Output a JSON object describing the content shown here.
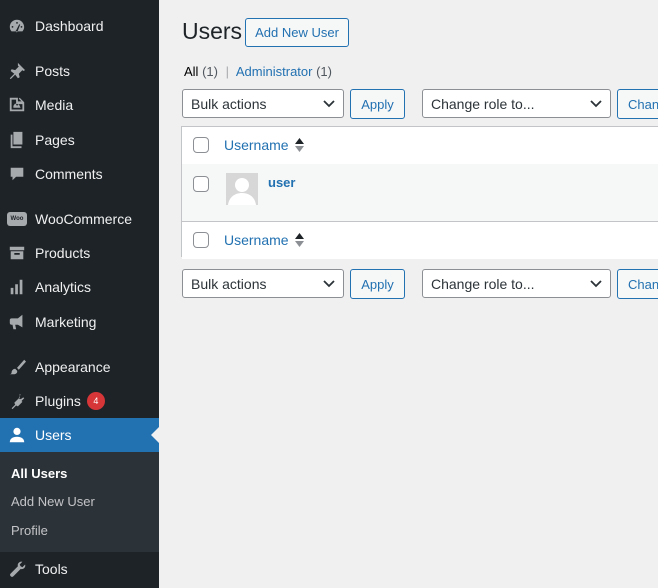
{
  "sidebar": {
    "items": [
      {
        "label": "Dashboard",
        "icon": "dashboard-icon"
      },
      {
        "label": "Posts",
        "icon": "pin-icon"
      },
      {
        "label": "Media",
        "icon": "media-icon"
      },
      {
        "label": "Pages",
        "icon": "pages-icon"
      },
      {
        "label": "Comments",
        "icon": "comment-icon"
      },
      {
        "label": "WooCommerce",
        "icon": "woo-icon",
        "icon_text": "Woo"
      },
      {
        "label": "Products",
        "icon": "archive-icon"
      },
      {
        "label": "Analytics",
        "icon": "bar-chart-icon"
      },
      {
        "label": "Marketing",
        "icon": "megaphone-icon"
      },
      {
        "label": "Appearance",
        "icon": "brush-icon"
      },
      {
        "label": "Plugins",
        "icon": "plug-icon",
        "badge": "4"
      },
      {
        "label": "Users",
        "icon": "user-icon"
      },
      {
        "label": "Tools",
        "icon": "wrench-icon"
      }
    ],
    "submenu": [
      {
        "label": "All Users"
      },
      {
        "label": "Add New User"
      },
      {
        "label": "Profile"
      }
    ]
  },
  "colors": {
    "sidebar_bg": "#1d2327",
    "accent": "#2271b1",
    "badge": "#d63638"
  },
  "page": {
    "title": "Users",
    "add_new_label": "Add New User"
  },
  "filters": {
    "all_label": "All",
    "all_count": "(1)",
    "separator": "|",
    "admin_label": "Administrator",
    "admin_count": "(1)"
  },
  "bulk": {
    "bulk_label": "Bulk actions",
    "apply_label": "Apply",
    "role_label": "Change role to...",
    "change_label": "Change"
  },
  "table": {
    "column_header": "Username",
    "rows": [
      {
        "username": "user"
      }
    ]
  }
}
